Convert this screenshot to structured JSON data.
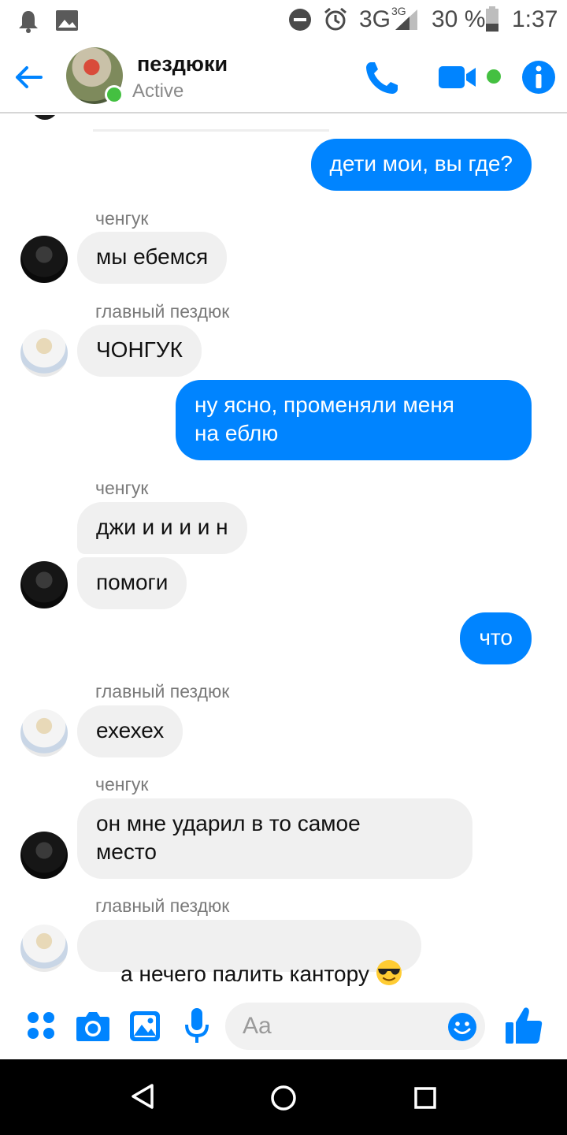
{
  "status_bar": {
    "network": "3G",
    "network_sup": "3G",
    "battery": "30 %",
    "time": "1:37"
  },
  "header": {
    "title": "пездюки",
    "status": "Active",
    "accent_color": "#0084ff",
    "online_color": "#44c041"
  },
  "messages": [
    {
      "type": "outgoing",
      "text": "дети мои, вы где?"
    },
    {
      "type": "sender",
      "text": "ченгук"
    },
    {
      "type": "incoming",
      "text": "мы ебемся"
    },
    {
      "type": "sender",
      "text": "главный пездюк"
    },
    {
      "type": "incoming",
      "text": "ЧОНГУК"
    },
    {
      "type": "outgoing",
      "text": "ну ясно, променяли меня\nна еблю"
    },
    {
      "type": "sender",
      "text": "ченгук"
    },
    {
      "type": "incoming",
      "text": "джи и и и и н"
    },
    {
      "type": "incoming",
      "text": "помоги"
    },
    {
      "type": "outgoing",
      "text": "что"
    },
    {
      "type": "sender",
      "text": "главный пездюк"
    },
    {
      "type": "incoming",
      "text": "ехехех"
    },
    {
      "type": "sender",
      "text": "ченгук"
    },
    {
      "type": "incoming",
      "text": "он мне ударил в то самое\nместо"
    },
    {
      "type": "sender",
      "text": "главный пездюк"
    },
    {
      "type": "incoming",
      "text": "а нечего палить кантору ",
      "emoji": "sunglasses-emoji"
    }
  ],
  "composer": {
    "placeholder": "Aa"
  },
  "icons": {
    "back": "back-arrow-icon",
    "call": "phone-icon",
    "video": "video-camera-icon",
    "info": "info-icon",
    "apps": "apps-icon",
    "camera": "camera-icon",
    "gallery": "image-icon",
    "mic": "microphone-icon",
    "emoji": "smiley-icon",
    "like": "thumbs-up-icon"
  }
}
